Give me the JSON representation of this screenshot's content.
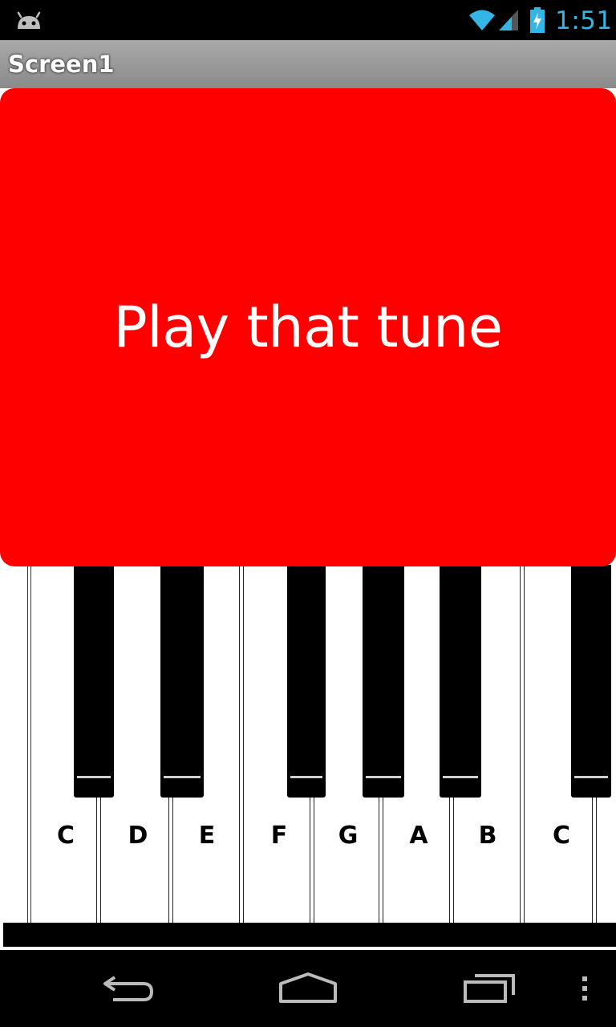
{
  "status_bar": {
    "time": "1:51",
    "icons": [
      "android-icon",
      "wifi-icon",
      "signal-icon",
      "battery-charging-icon"
    ],
    "clock_color": "#33b5e5"
  },
  "title_bar": {
    "title": "Screen1"
  },
  "play_button": {
    "label": "Play that tune",
    "color": "#ff0000"
  },
  "piano": {
    "notes": [
      "C",
      "D",
      "E",
      "F",
      "G",
      "A",
      "B",
      "C"
    ]
  },
  "nav_bar": {
    "icons": [
      "back-icon",
      "home-icon",
      "recent-apps-icon",
      "overflow-menu-icon"
    ]
  }
}
